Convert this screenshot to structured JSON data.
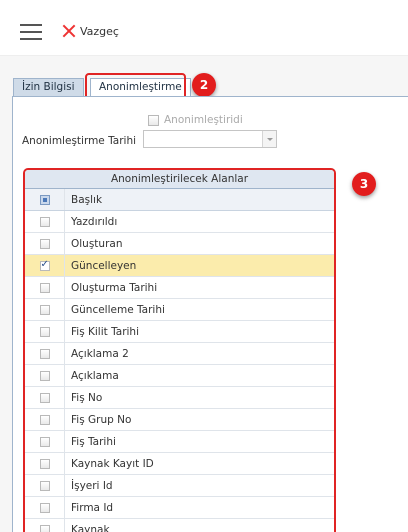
{
  "toolbar": {
    "cancel_label": "Vazgeç"
  },
  "tabs": [
    {
      "label": "İzin Bilgisi",
      "active": false
    },
    {
      "label": "Anonimleştirme",
      "active": true
    }
  ],
  "badges": {
    "tab_badge": "2",
    "grid_badge": "3"
  },
  "form": {
    "anonymized_label": "Anonimleştiridi",
    "anonymized_checked": false,
    "date_label": "Anonimleştirme Tarihi",
    "date_value": ""
  },
  "grid": {
    "title": "Anonimleştirilecek Alanlar",
    "column_header": "Başlık",
    "rows": [
      {
        "label": "Yazdırıldı",
        "checked": false
      },
      {
        "label": "Oluşturan",
        "checked": false
      },
      {
        "label": "Güncelleyen",
        "checked": true
      },
      {
        "label": "Oluşturma Tarihi",
        "checked": false
      },
      {
        "label": "Güncelleme Tarihi",
        "checked": false
      },
      {
        "label": "Fiş Kilit Tarihi",
        "checked": false
      },
      {
        "label": "Açıklama 2",
        "checked": false
      },
      {
        "label": "Açıklama",
        "checked": false
      },
      {
        "label": "Fiş No",
        "checked": false
      },
      {
        "label": "Fiş Grup No",
        "checked": false
      },
      {
        "label": "Fiş Tarihi",
        "checked": false
      },
      {
        "label": "Kaynak Kayıt ID",
        "checked": false
      },
      {
        "label": "İşyeri Id",
        "checked": false
      },
      {
        "label": "Firma Id",
        "checked": false
      },
      {
        "label": "Kaynak",
        "checked": false
      }
    ]
  },
  "colors": {
    "accent_red": "#e02424",
    "selected_row": "#fbecac",
    "tab_border": "#9fb4cc"
  }
}
